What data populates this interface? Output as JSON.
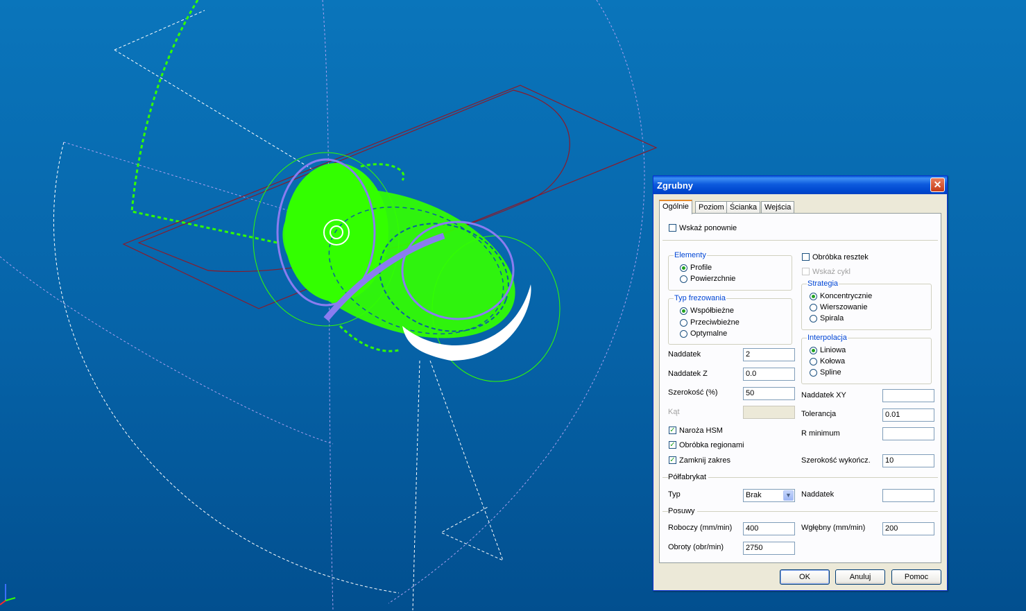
{
  "dialog": {
    "title": "Zgrubny",
    "close_glyph": "✕",
    "tabs": [
      "Ogólnie",
      "Poziom",
      "Ścianka",
      "Wejścia"
    ],
    "active_tab": "Ogólnie",
    "wskaz_ponownie": {
      "label": "Wskaż ponownie",
      "checked": false
    },
    "elementy": {
      "legend": "Elementy",
      "options": [
        "Profile",
        "Powierzchnie"
      ],
      "selected": "Profile"
    },
    "typ_frezowania": {
      "legend": "Typ frezowania",
      "options": [
        "Współbieżne",
        "Przeciwbieżne",
        "Optymalne"
      ],
      "selected": "Współbieżne"
    },
    "obrobka_resztek": {
      "label": "Obróbka resztek",
      "checked": false
    },
    "wskaz_cykl": {
      "label": "Wskaż cykl",
      "checked": false,
      "disabled": true
    },
    "strategia": {
      "legend": "Strategia",
      "options": [
        "Koncentrycznie",
        "Wierszowanie",
        "Spirala"
      ],
      "selected": "Koncentrycznie"
    },
    "interpolacja": {
      "legend": "Interpolacja",
      "options": [
        "Liniowa",
        "Kołowa",
        "Spline"
      ],
      "selected": "Liniowa"
    },
    "fields_left": {
      "naddatek": {
        "label": "Naddatek",
        "value": "2"
      },
      "naddatek_z": {
        "label": "Naddatek Z",
        "value": "0.0"
      },
      "szerokosc": {
        "label": "Szerokość (%)",
        "value": "50"
      },
      "kat": {
        "label": "Kąt",
        "value": ""
      }
    },
    "fields_right": {
      "naddatek_xy": {
        "label": "Naddatek XY",
        "value": ""
      },
      "tolerancja": {
        "label": "Tolerancja",
        "value": "0.01"
      },
      "r_minimum": {
        "label": "R minimum",
        "value": ""
      },
      "szerokosc_wykoncz": {
        "label": "Szerokość wykończ.",
        "value": "10"
      }
    },
    "checks": {
      "naroza_hsm": {
        "label": "Naroża HSM",
        "checked": true
      },
      "obrobka_regionami": {
        "label": "Obróbka regionami",
        "checked": true
      },
      "zamknij_zakres": {
        "label": "Zamknij zakres",
        "checked": true
      }
    },
    "polfabrykat": {
      "section": "Półfabrykat",
      "typ_label": "Typ",
      "typ_value": "Brak",
      "naddatek_label": "Naddatek",
      "naddatek_value": ""
    },
    "posuwy": {
      "section": "Posuwy",
      "roboczy_label": "Roboczy (mm/min)",
      "roboczy_value": "400",
      "wglebny_label": "Wgłębny (mm/min)",
      "wglebny_value": "200",
      "obroty_label": "Obroty (obr/min)",
      "obroty_value": "2750"
    },
    "buttons": {
      "ok": "OK",
      "cancel": "Anuluj",
      "help": "Pomoc"
    }
  },
  "colors": {
    "toolpath_green": "#33ff00",
    "toolpath_purple": "#8a7cf0",
    "outline_red": "#8b1a2a",
    "helper_white": "#ffffff",
    "helper_lavender": "#a9a0f0",
    "background_blue": "#0663a8"
  },
  "icons": {
    "axis_triad": "axis-triad-icon",
    "check_mark": "✓",
    "dropdown": "▼"
  }
}
